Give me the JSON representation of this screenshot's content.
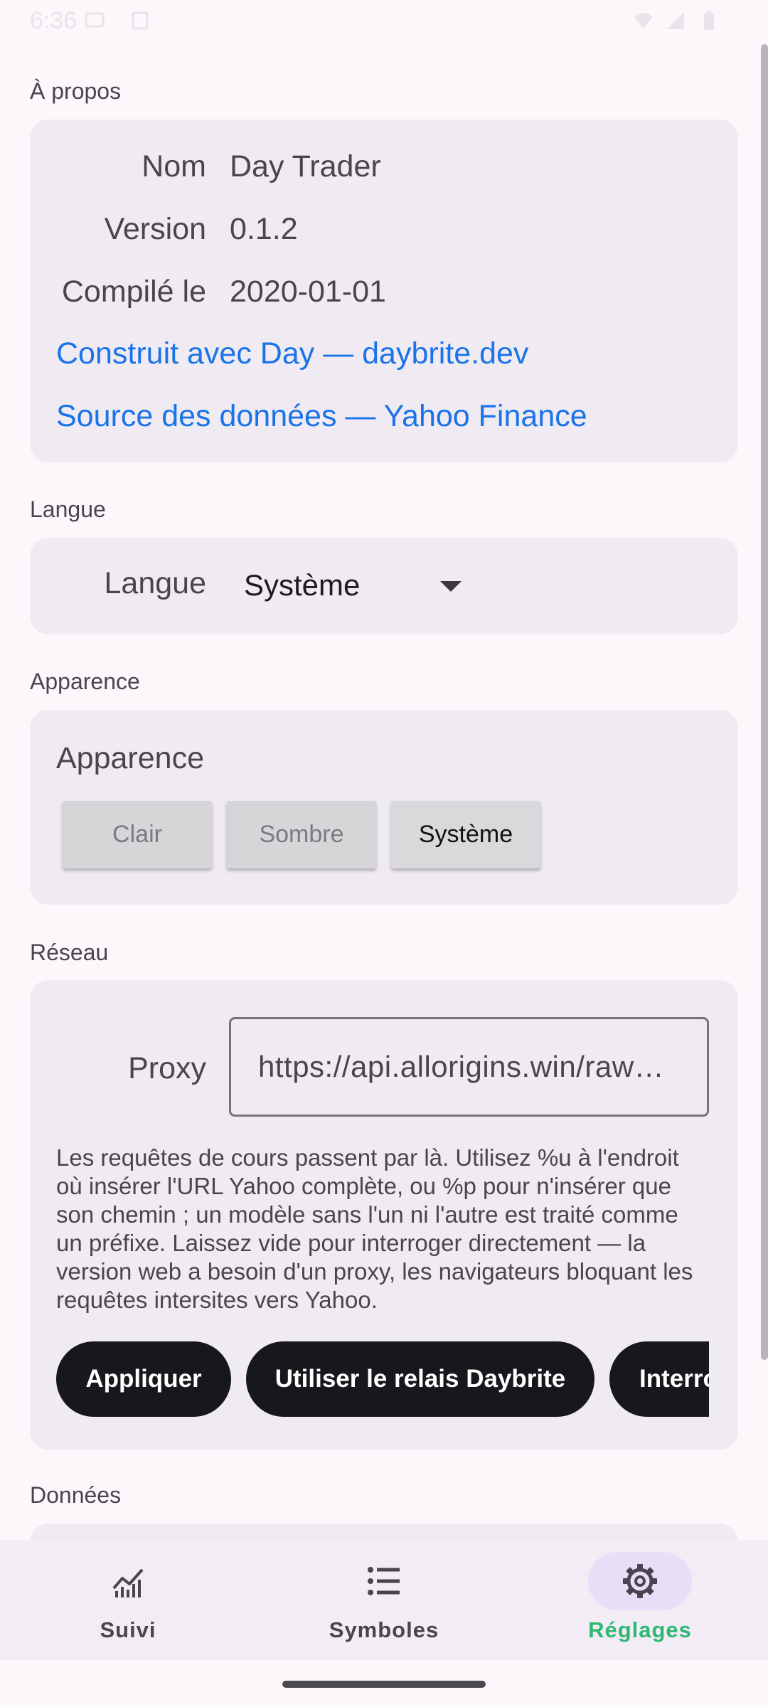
{
  "status_bar": {
    "time": "6:36"
  },
  "about": {
    "section_title": "À propos",
    "rows": [
      {
        "key": "Nom",
        "value": "Day Trader"
      },
      {
        "key": "Version",
        "value": "0.1.2"
      },
      {
        "key": "Compilé le",
        "value": "2020-01-01"
      }
    ],
    "links": [
      "Construit avec Day — daybrite.dev",
      "Source des données — Yahoo Finance"
    ]
  },
  "language": {
    "section_title": "Langue",
    "label": "Langue",
    "selected": "Système"
  },
  "appearance": {
    "section_title": "Apparence",
    "label": "Apparence",
    "options": [
      "Clair",
      "Sombre",
      "Système"
    ],
    "selected": "Système"
  },
  "network": {
    "section_title": "Réseau",
    "proxy_label": "Proxy",
    "proxy_value": "https://api.allorigins.win/raw?url=%u",
    "help": "Les requêtes de cours passent par là. Utilisez %u à l'endroit où insérer l'URL Yahoo complète, ou %p pour n'insérer que son chemin ; un modèle sans l'un ni l'autre est traité comme un préfixe. Laissez vide pour interroger directement — la version web a besoin d'un proxy, les navigateurs bloquant les requêtes intersites vers Yahoo.",
    "buttons": [
      "Appliquer",
      "Utiliser le relais Daybrite",
      "Interroger"
    ]
  },
  "data_section": {
    "section_title": "Données"
  },
  "nav": {
    "items": [
      {
        "label": "Suivi",
        "icon": "chart-line-icon"
      },
      {
        "label": "Symboles",
        "icon": "list-icon"
      },
      {
        "label": "Réglages",
        "icon": "gear-icon"
      }
    ],
    "active": "Réglages",
    "active_color": "#2eb872"
  }
}
